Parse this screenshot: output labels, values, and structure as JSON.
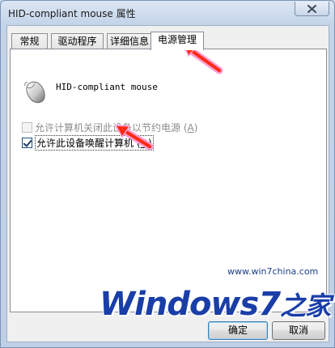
{
  "window": {
    "title": "HID-compliant mouse 属性"
  },
  "tabs": [
    {
      "label": "常规"
    },
    {
      "label": "驱动程序"
    },
    {
      "label": "详细信息"
    },
    {
      "label": "电源管理"
    }
  ],
  "device": {
    "name": "HID-compliant mouse",
    "icon": "mouse-icon"
  },
  "options": [
    {
      "label": "允许计算机关闭此设备以节约电源",
      "accel": "A",
      "checked": false,
      "enabled": false
    },
    {
      "label": "允许此设备唤醒计算机",
      "accel": "O",
      "checked": true,
      "enabled": true
    }
  ],
  "buttons": {
    "ok": "确定",
    "cancel": "取消"
  },
  "watermark": {
    "url": "www.win7china.com",
    "logo_main": "Windows",
    "logo_seven": "7",
    "logo_suffix": "之家"
  },
  "colors": {
    "arrow": "#ff2a12",
    "arrow_glow": "#ff9bd2",
    "logo": "#1a3ea8"
  }
}
